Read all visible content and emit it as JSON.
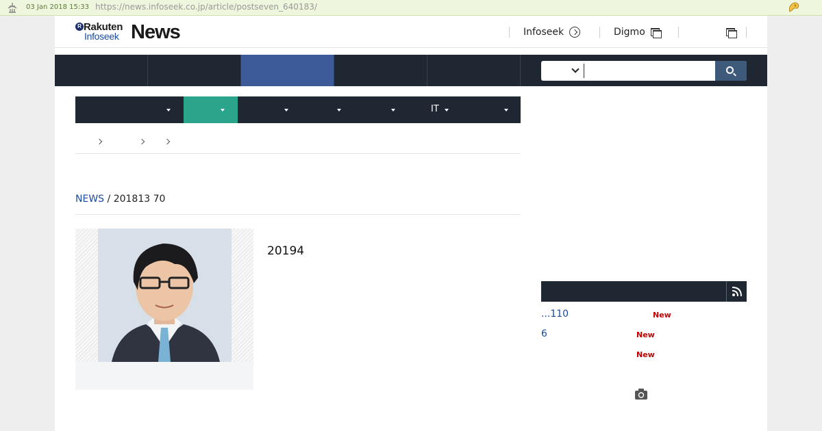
{
  "archive": {
    "date": "03 Jan 2018 15:33",
    "url": "https://news.infoseek.co.jp/article/postseven_640183/"
  },
  "header": {
    "logo_r": "R",
    "logo_rakuten": "Rakuten",
    "logo_infoseek": "Infoseek",
    "logo_news": "News",
    "links": [
      {
        "label": "Infoseek",
        "icon": "circle-arrow-icon"
      },
      {
        "label": "Digmo",
        "icon": "external-window-icon"
      },
      {
        "label": "",
        "icon": "external-window-icon"
      }
    ]
  },
  "search": {
    "placeholder": "",
    "value": ""
  },
  "category_nav": {
    "items": [
      {
        "label": ""
      },
      {
        "label": ""
      },
      {
        "label": ""
      },
      {
        "label": ""
      },
      {
        "label": ""
      },
      {
        "label": "IT"
      },
      {
        "label": ""
      }
    ]
  },
  "source": {
    "link": "NEWS",
    "sep": " / ",
    "date": "201813 70"
  },
  "article": {
    "headline": "20194"
  },
  "ranking": {
    "items": [
      {
        "title": "...110",
        "badge": "New"
      },
      {
        "title": "6",
        "badge": "New"
      },
      {
        "title": "",
        "badge": "New"
      }
    ]
  },
  "colors": {
    "nav_bg": "#1e2732",
    "nav_active": "#3d5a99",
    "category_active": "#2aa58c",
    "link": "#1b4a9c",
    "new_badge": "#c40000"
  }
}
